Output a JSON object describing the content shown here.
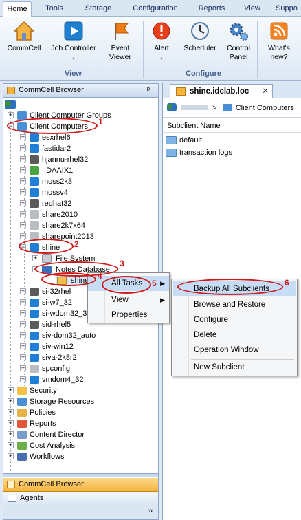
{
  "ribbon_tabs": [
    "Home",
    "Tools",
    "Storage",
    "Configuration",
    "Reports",
    "View",
    "Suppo"
  ],
  "ribbon_buttons": [
    {
      "label": "CommCell",
      "icon": "home-icon"
    },
    {
      "label": "Job Controller",
      "icon": "play-icon"
    },
    {
      "label": "Event Viewer",
      "icon": "flag-icon"
    },
    {
      "label": "Alert",
      "icon": "alert-icon"
    },
    {
      "label": "Scheduler",
      "icon": "clock-icon"
    },
    {
      "label": "Control Panel",
      "icon": "gears-icon"
    },
    {
      "label": "What's new?",
      "icon": "rss-icon"
    }
  ],
  "ribbon_groups": {
    "view": "View",
    "configure": "Configure"
  },
  "left_pane": {
    "title": "CommCell Browser",
    "pin": "ᵖ",
    "tree": {
      "root": "",
      "groups": "Client Computer Groups",
      "clients": "Client Computers",
      "client_list_a": [
        "esxrhel6",
        "fastidar2",
        "hjannu-rhel32",
        "IIDAAIX1",
        "moss2k3",
        "mossv4",
        "redhat32",
        "share2010",
        "share2k7x64",
        "sharepoint2013"
      ],
      "shine": "shine",
      "file_system": "File System",
      "notes_database": "Notes Database",
      "shine_instance": "shine",
      "client_list_b": [
        "si-32rhel",
        "si-w7_32",
        "si-wdom32_32",
        "sid-rhel5",
        "siv-dom32_auto",
        "siv-win12",
        "siva-2k8r2",
        "spconfig",
        "vmdom4_32"
      ],
      "top_level": [
        "Security",
        "Storage Resources",
        "Policies",
        "Reports",
        "Content Director",
        "Cost Analysis",
        "Workflows"
      ]
    },
    "bottom_title": "CommCell Browser",
    "agents": "Agents",
    "more": "»"
  },
  "right_pane": {
    "tab_title": "shine.idclab.loc",
    "close": "✕",
    "crumb_sep": ">",
    "crumb": "Client Computers",
    "crumb_more": "»",
    "column": "Subclient Name",
    "rows": [
      "default",
      "transaction logs"
    ]
  },
  "context_menu": {
    "items": [
      "All Tasks",
      "View",
      "Properties"
    ],
    "arrow": "▶"
  },
  "submenu": {
    "items": [
      "Backup All Subclients",
      "Browse and Restore",
      "Configure",
      "Delete",
      "Operation Window",
      "New Subclient"
    ]
  },
  "callouts": [
    "1",
    "2",
    "3",
    "4",
    "5",
    "6"
  ],
  "colors": {
    "accent_orange": "#f6b43f",
    "callout_red": "#d01818",
    "ribbon_label": "#45618f"
  }
}
